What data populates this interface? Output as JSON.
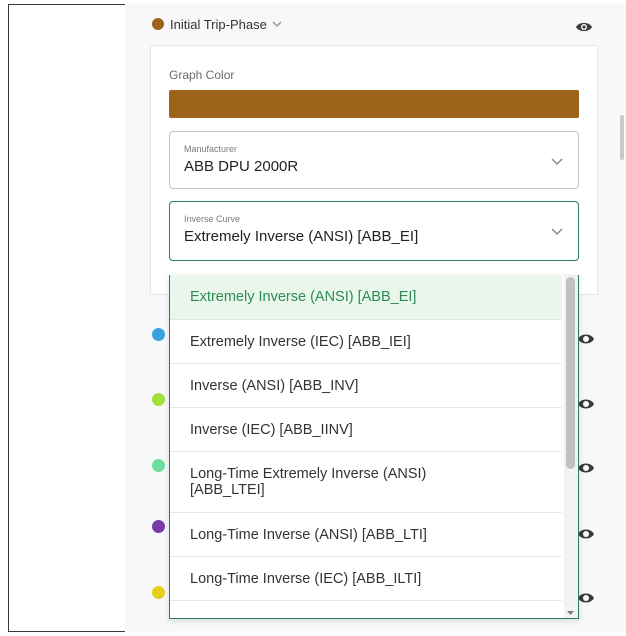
{
  "phase": {
    "title": "Initial Trip-Phase",
    "dot_color": "#9c6418",
    "icon": "eye-icon"
  },
  "graph_color": {
    "label": "Graph Color",
    "value": "#9c6418"
  },
  "manufacturer": {
    "label": "Manufacturer",
    "value": "ABB DPU 2000R"
  },
  "inverse_curve": {
    "label": "Inverse Curve",
    "value": "Extremely Inverse (ANSI) [ABB_EI]",
    "accent": "#2e7d5a"
  },
  "dropdown": {
    "options": [
      "Extremely Inverse (ANSI) [ABB_EI]",
      "Extremely Inverse (IEC) [ABB_IEI]",
      "Inverse (ANSI) [ABB_INV]",
      "Inverse (IEC) [ABB_IINV]",
      "Long-Time Extremely Inverse (ANSI) [ABB_LTEI]",
      "Long-Time Inverse (ANSI) [ABB_LTI]",
      "Long-Time Inverse (IEC) [ABB_ILTI]"
    ],
    "selected_index": 0
  },
  "other_phases": [
    {
      "dot_color": "#3aa0e0"
    },
    {
      "dot_color": "#a3e03a"
    },
    {
      "dot_color": "#6de0a0"
    },
    {
      "dot_color": "#7a3aa8"
    },
    {
      "dot_color": "#e6cf1a"
    }
  ]
}
